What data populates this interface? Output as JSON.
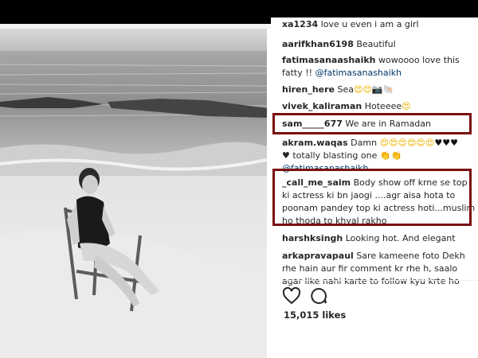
{
  "comments": [
    {
      "user": "xa1234",
      "text": "love u even i am a girl"
    },
    {
      "user": "aarifkhan6198",
      "text": "Beautiful"
    },
    {
      "user": "fatimasanaashaikh",
      "text": "wowoooo love this fatty !!",
      "mention": "@fatimasanashaikh"
    },
    {
      "user": "hiren_here",
      "text": "Sea",
      "emoji": "😍😍📷🐚"
    },
    {
      "user": "vivek_kaliraman",
      "text": "Hoteeee",
      "emoji": "😍"
    },
    {
      "user": "sam_____677",
      "text": "We are in Ramadan"
    },
    {
      "user": "akram.waqas",
      "text": "Damn",
      "emoji": "😍😍😍😍😍😍",
      "hearts": "♥♥♥",
      "text2": "♥ totally blasting one",
      "emoji2": "👏👏",
      "mention": "@fatimasanashaikh"
    },
    {
      "user": "_call_me_saim",
      "text": "Body show off krne se top ki actress ki bn jaogi ....agr aisa hota to poonam pandey top ki actress hoti...muslim ho thoda to khyal rakho"
    },
    {
      "user": "harshksingh",
      "text": "Looking hot. And elegant"
    },
    {
      "user": "arkapravapaul",
      "text": "Sare kameene foto Dekh rhe hain aur fir comment kr rhe h, saalo agar like nahi karte to follow kyu krte ho"
    }
  ],
  "likes": "15,015 likes",
  "icons": {
    "like": "heart-outline-icon",
    "comment": "comment-bubble-icon"
  },
  "colors": {
    "highlight": "#7a1010",
    "mention": "#003569"
  }
}
